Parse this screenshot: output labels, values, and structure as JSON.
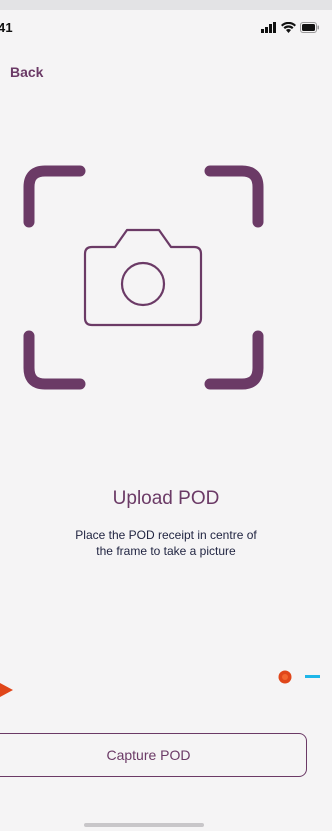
{
  "status_bar": {
    "time": "41",
    "icons": [
      "signal-icon",
      "wifi-icon",
      "battery-icon"
    ]
  },
  "nav": {
    "back_label": "Back"
  },
  "upload": {
    "title": "Upload POD",
    "instruction_line1": "Place the POD receipt in centre of",
    "instruction_line2": "the frame to take a picture"
  },
  "actions": {
    "capture_label": "Capture POD"
  },
  "colors": {
    "primary": "#6b3a66",
    "background": "#f5f4f5",
    "text_dark": "#1f2340",
    "accent_orange": "#e0461a",
    "accent_blue": "#1fb6e8"
  }
}
